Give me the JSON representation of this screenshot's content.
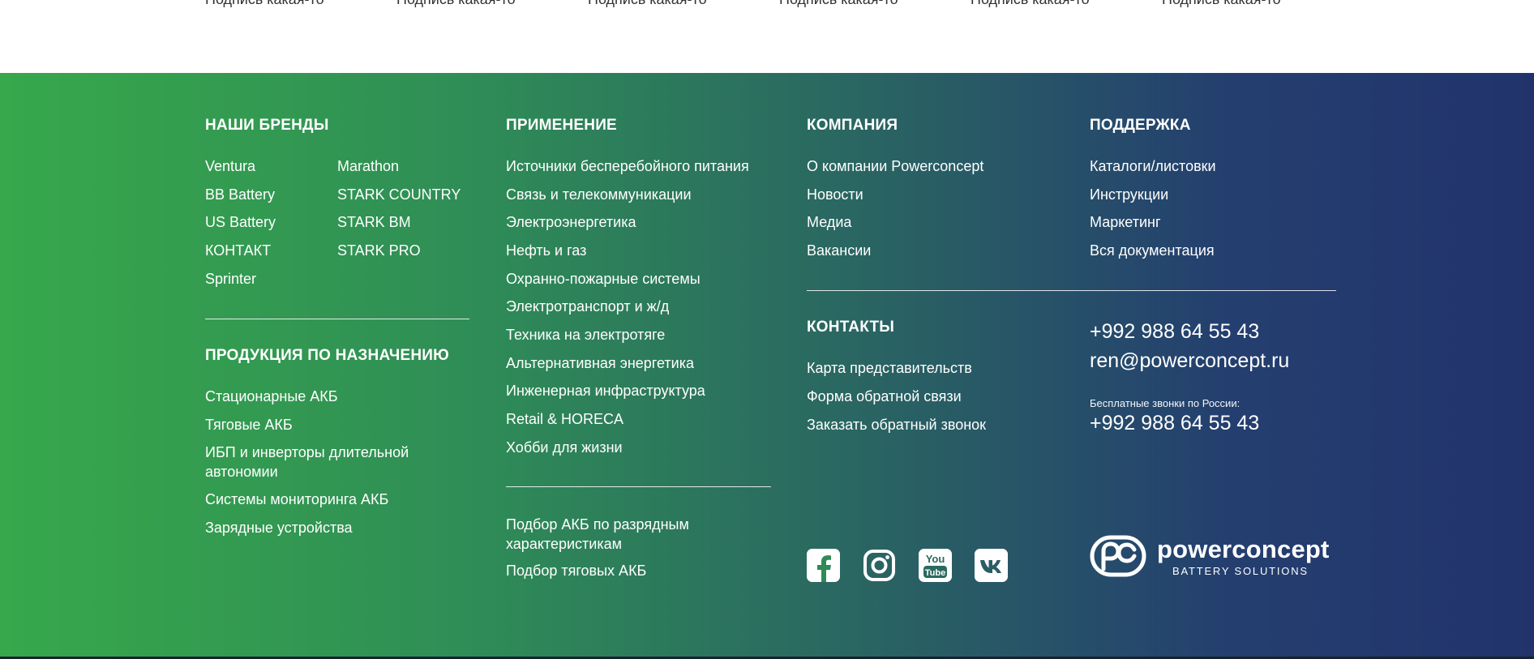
{
  "top_captions": [
    "Подпись какая-то",
    "Подпись какая-то",
    "Подпись какая-то",
    "Подпись какая-то",
    "Подпись какая-то",
    "Подпись какая-то"
  ],
  "brands": {
    "heading": "НАШИ БРЕНДЫ",
    "col1": [
      "Ventura",
      "BB Battery",
      "US Battery",
      "КОНТАКТ",
      "Sprinter"
    ],
    "col2": [
      "Marathon",
      "STARK COUNTRY",
      "STARK BM",
      "STARK PRO"
    ]
  },
  "products": {
    "heading": "ПРОДУКЦИЯ ПО НАЗНАЧЕНИЮ",
    "items": [
      "Стационарные АКБ",
      "Тяговые АКБ",
      "ИБП и инверторы длительной автономии",
      "Системы мониторинга АКБ",
      "Зарядные устройства"
    ]
  },
  "application": {
    "heading": "ПРИМЕНЕНИЕ",
    "items": [
      "Источники бесперебойного питания",
      "Связь и телекоммуникации",
      "Электроэнергетика",
      "Нефть и газ",
      "Охранно-пожарные системы",
      "Электротранспорт и ж/д",
      "Техника на электротяге",
      "Альтернативная энергетика",
      "Инженерная инфраструктура",
      "Retail & HORECA",
      "Хобби для жизни"
    ],
    "extra": [
      "Подбор АКБ по разрядным характеристикам",
      "Подбор тяговых АКБ"
    ]
  },
  "company": {
    "heading": "КОМПАНИЯ",
    "items": [
      "О компании Powerconcept",
      "Новости",
      "Медиа",
      "Вакансии"
    ]
  },
  "support": {
    "heading": "ПОДДЕРЖКА",
    "items": [
      "Каталоги/листовки",
      "Инструкции",
      "Маркетинг",
      "Вся документация"
    ]
  },
  "contacts": {
    "heading": "КОНТАКТЫ",
    "items": [
      "Карта представительств",
      "Форма обратной связи",
      "Заказать обратный звонок"
    ],
    "phone": "+992 988 64 55 43",
    "email": "ren@powerconcept.ru",
    "free_calls_label": "Бесплатные звонки по России:",
    "free_phone": "+992 988 64 55 43"
  },
  "social": {
    "icons": [
      "facebook-icon",
      "instagram-icon",
      "youtube-icon",
      "vk-icon"
    ],
    "youtube_text_top": "You",
    "youtube_text_bottom": "Tube"
  },
  "logo": {
    "word": "powerconcept",
    "tagline": "BATTERY SOLUTIONS"
  },
  "colors": {
    "gradient_start": "#37a84b",
    "gradient_end": "#22336c",
    "text": "#ffffff"
  }
}
